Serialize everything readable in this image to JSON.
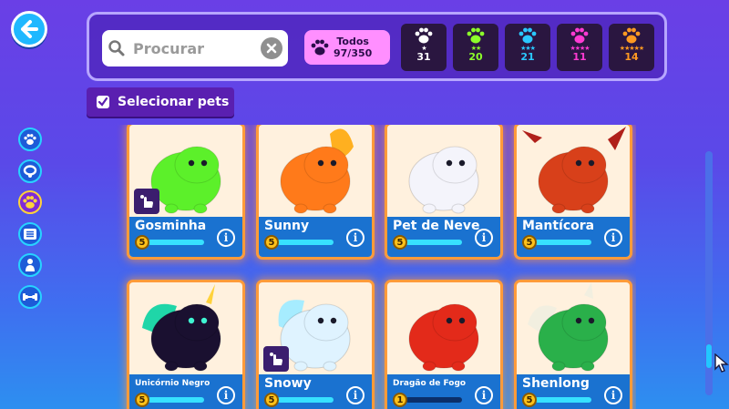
{
  "header": {
    "search_placeholder": "Procurar",
    "all_filter": {
      "line1": "Todos",
      "line2": "97/350"
    },
    "rarities": [
      {
        "stars": "★",
        "count": "31",
        "color": "#ffffff"
      },
      {
        "stars": "★★",
        "count": "20",
        "color": "#8cff2a"
      },
      {
        "stars": "★★★",
        "count": "21",
        "color": "#2ac8ff"
      },
      {
        "stars": "★★★★",
        "count": "11",
        "color": "#ff3ad2"
      },
      {
        "stars": "★★★★★",
        "count": "14",
        "color": "#ff9a22"
      }
    ]
  },
  "select_button": {
    "label": "Selecionar pets"
  },
  "side_nav": [
    {
      "icon": "paw-icon",
      "active": false
    },
    {
      "icon": "collar-icon",
      "active": false
    },
    {
      "icon": "paw-group-icon",
      "active": true
    },
    {
      "icon": "list-icon",
      "active": false
    },
    {
      "icon": "person-icon",
      "active": false
    },
    {
      "icon": "dumbbell-icon",
      "active": false
    }
  ],
  "pets": [
    {
      "name": "Gosminha",
      "level": "5",
      "progress": 1.0,
      "badge": true,
      "color": "#5cf02a"
    },
    {
      "name": "Sunny",
      "level": "5",
      "progress": 1.0,
      "badge": false,
      "color": "#ff7a1a"
    },
    {
      "name": "Pet de Neve",
      "level": "5",
      "progress": 1.0,
      "badge": false,
      "color": "#f4f4fb"
    },
    {
      "name": "Mantícora",
      "level": "5",
      "progress": 1.0,
      "badge": false,
      "color": "#d8401a"
    },
    {
      "name": "Unicórnio Negro",
      "level": "5",
      "progress": 1.0,
      "badge": false,
      "color": "#1a1030"
    },
    {
      "name": "Snowy",
      "level": "5",
      "progress": 1.0,
      "badge": true,
      "color": "#dff3ff"
    },
    {
      "name": "Dragão de Fogo",
      "level": "1",
      "progress": 0.0,
      "badge": false,
      "color": "#e32a1a"
    },
    {
      "name": "Shenlong",
      "level": "5",
      "progress": 1.0,
      "badge": false,
      "color": "#2ab04a"
    }
  ]
}
